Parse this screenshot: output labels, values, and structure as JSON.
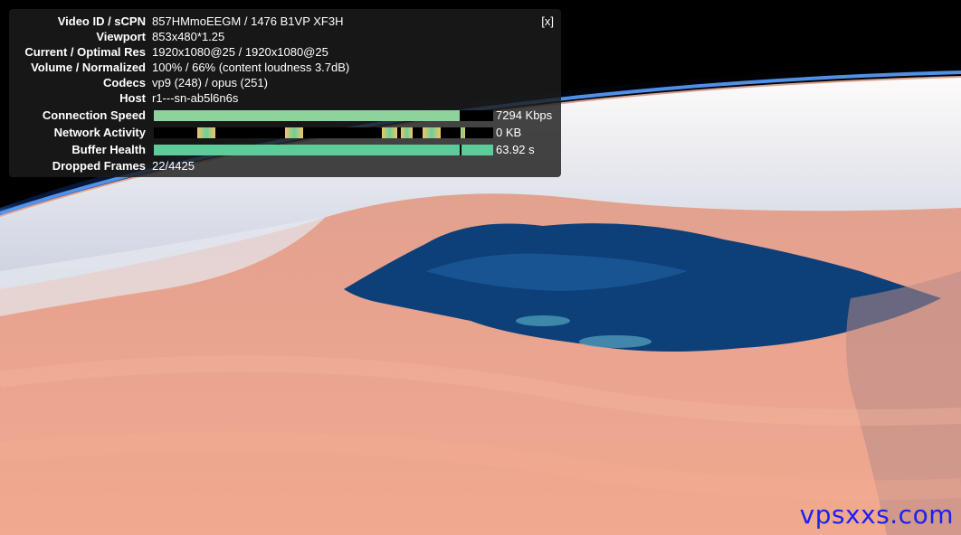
{
  "video": {
    "scene": "earth-from-orbit-icon",
    "watermark": "vpsxxs.com"
  },
  "stats": {
    "close_label": "[x]",
    "rows": {
      "video_id": {
        "label": "Video ID / sCPN",
        "value": "857HMmoEEGM / 1476 B1VP XF3H"
      },
      "viewport": {
        "label": "Viewport",
        "value": "853x480*1.25"
      },
      "resolution": {
        "label": "Current / Optimal Res",
        "value": "1920x1080@25 / 1920x1080@25"
      },
      "volume": {
        "label": "Volume / Normalized",
        "value": "100% / 66% (content loudness 3.7dB)"
      },
      "codecs": {
        "label": "Codecs",
        "value": "vp9 (248) / opus (251)"
      },
      "host": {
        "label": "Host",
        "value": "r1---sn-ab5l6n6s"
      },
      "connection_speed": {
        "label": "Connection Speed",
        "value": "7294 Kbps",
        "fill_fraction": 0.9
      },
      "network_activity": {
        "label": "Network Activity",
        "value": "0 KB"
      },
      "buffer_health": {
        "label": "Buffer Health",
        "value": "63.92 s",
        "fill_fraction": 1.0
      },
      "dropped_frames": {
        "label": "Dropped Frames",
        "value": "22/4425"
      }
    }
  },
  "colors": {
    "connection_bar": "#8fd39c",
    "buffer_bar": "#5ecb9a",
    "network_spike_a": "#f2c46b",
    "network_spike_b": "#6fcf97",
    "watermark": "#1c22ee"
  }
}
